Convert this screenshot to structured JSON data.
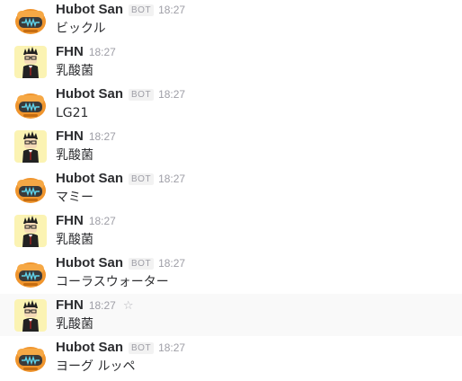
{
  "messages": [
    {
      "author": "Hubot San",
      "badge": "BOT",
      "time": "18:27",
      "text": "ビックル",
      "avatar": "hubot-robot-avatar"
    },
    {
      "author": "FHN",
      "badge": "",
      "time": "18:27",
      "text": "乳酸菌",
      "avatar": "fhn-user-avatar"
    },
    {
      "author": "Hubot San",
      "badge": "BOT",
      "time": "18:27",
      "text": "LG21",
      "avatar": "hubot-robot-avatar"
    },
    {
      "author": "FHN",
      "badge": "",
      "time": "18:27",
      "text": "乳酸菌",
      "avatar": "fhn-user-avatar"
    },
    {
      "author": "Hubot San",
      "badge": "BOT",
      "time": "18:27",
      "text": "マミー",
      "avatar": "hubot-robot-avatar"
    },
    {
      "author": "FHN",
      "badge": "",
      "time": "18:27",
      "text": "乳酸菌",
      "avatar": "fhn-user-avatar"
    },
    {
      "author": "Hubot San",
      "badge": "BOT",
      "time": "18:27",
      "text": "コーラスウォーター",
      "avatar": "hubot-robot-avatar"
    },
    {
      "author": "FHN",
      "badge": "",
      "time": "18:27",
      "text": "乳酸菌",
      "avatar": "fhn-user-avatar",
      "hovered": true,
      "star_icon": "star-outline-icon"
    },
    {
      "author": "Hubot San",
      "badge": "BOT",
      "time": "18:27",
      "text": "ヨーグ ルッペ",
      "avatar": "hubot-robot-avatar"
    }
  ],
  "colors": {
    "text": "#2c2d30",
    "muted": "#9e9ea6",
    "hubot_orange": "#f0952d",
    "hubot_screen": "#3b3b3b",
    "fhn_background": "#fbf3b3"
  }
}
